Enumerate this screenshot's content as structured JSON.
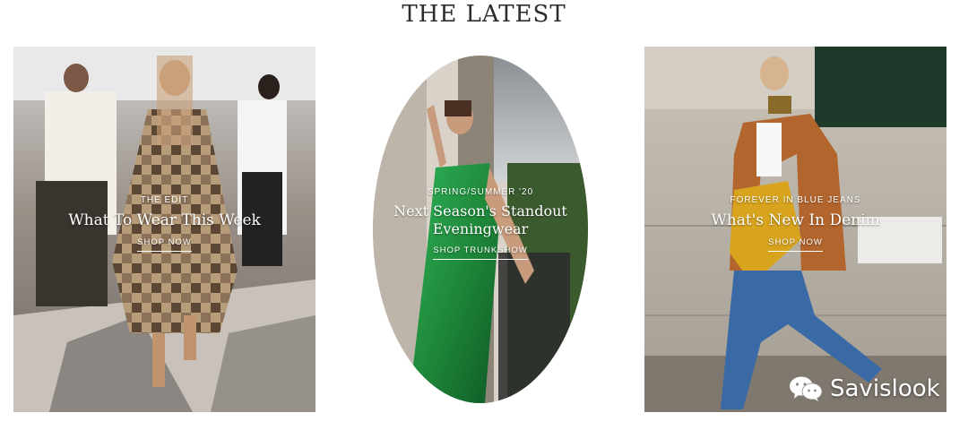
{
  "page": {
    "heading": "THE LATEST"
  },
  "cards": [
    {
      "kicker": "THE EDIT",
      "title": "What To Wear This Week",
      "cta": "SHOP NOW",
      "image_subject": "street-style women in checked coat and pleated skirt"
    },
    {
      "kicker": "SPRING/SUMMER '20",
      "title": "Next Season's Standout Eveningwear",
      "cta": "SHOP TRUNKSHOW",
      "image_subject": "woman in green satin slip dress on balcony"
    },
    {
      "kicker": "FOREVER IN BLUE JEANS",
      "title": "What's New In Denim",
      "cta": "SHOP NOW",
      "image_subject": "woman in camel blazer and blue jeans with yellow bag"
    }
  ],
  "watermark": {
    "text": "Savislook",
    "icon": "wechat-icon"
  },
  "colors": {
    "text": "#2c2c2c",
    "overlay_text": "#ffffff",
    "dress_green": "#1f8a3a",
    "blazer": "#b3652e",
    "denim": "#3a6aa6"
  }
}
